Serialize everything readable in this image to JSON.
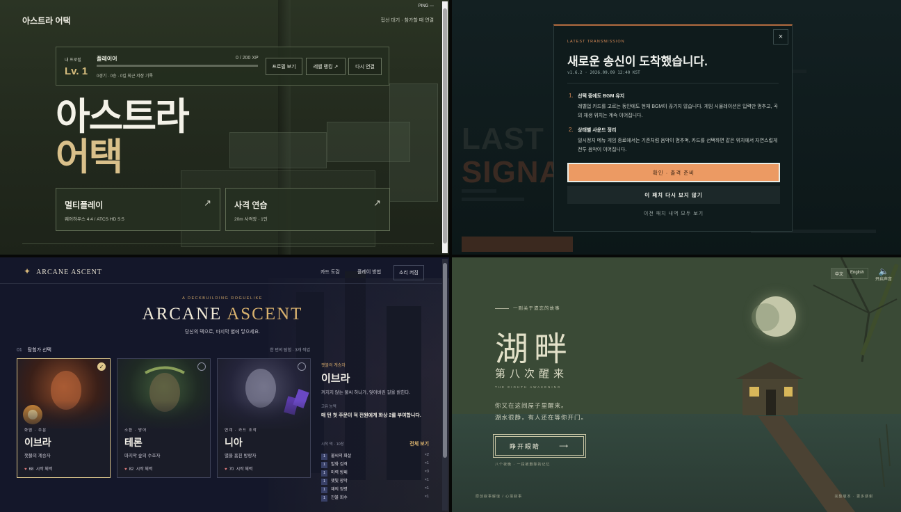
{
  "q1": {
    "logo": "아스트라 어택",
    "status": "접선 대기 · 참가할 때 연결",
    "ping": "PING —",
    "profile": {
      "label": "내 프로필",
      "level": "Lv. 1",
      "name": "플레이어",
      "xp_text": "0 / 200 XP",
      "xp_fraction": 0.0,
      "record": "0경기 · 0승 · 0킬  최근 저장 기록",
      "buttons": [
        "프로필 보기",
        "레벨 랭킹 ↗",
        "다시 연결"
      ]
    },
    "hero": {
      "line1": "아스트라",
      "line2": "어택"
    },
    "modes": [
      {
        "title": "멀티플레이",
        "sub": "웨어하우스 4:4 / ATCS HD S:5",
        "arrow": "↗"
      },
      {
        "title": "사격 연습",
        "sub": "20m 사격장 · 1인",
        "arrow": "↗"
      }
    ]
  },
  "q2": {
    "ghost": {
      "line1": "LAST",
      "line2": "SIGNA"
    },
    "modal": {
      "tag": "LATEST TRANSMISSION",
      "close": "×",
      "title": "새로운 송신이 도착했습니다.",
      "version": "v1.6.2 · 2026.09.09 12:40 KST",
      "items": [
        {
          "num": "1.",
          "head": "선택 중에도 BGM 유지",
          "body": "레벨업 카드를 고르는 동안에도 현재 BGM이 끊기지 않습니다. 게임 시뮬레이션은 입력만 멈추고, 곡의 재생 위치는 계속 이어집니다."
        },
        {
          "num": "2.",
          "head": "상태별 사운드 정리",
          "body": "일시정지 메뉴 게임 종료에서는 기존처럼 음악이 멈추며, 카드를 선택하면 같은 위치에서 자연스럽게 전투 음악이 이어집니다."
        }
      ],
      "confirm": "확인 · 출격 준비",
      "never": "이 패치 다시 보지 않기",
      "all": "이전 패치 내역 모두 보기"
    }
  },
  "q3": {
    "logo": "ARCANE ASCENT",
    "nav": [
      "카드 도감",
      "플레이 방법",
      "소리 켜짐"
    ],
    "kicker": "A DECKBUILDING ROGUELIKE",
    "title_a": "ARCANE ",
    "title_b": "ASCENT",
    "subtitle": "당신의 덱으로, 마지막 별에 닿으세요.",
    "section_num": "01",
    "section": "탐험가 선택",
    "count": "한 번의 탐험 · 3개 직업",
    "cards": [
      {
        "role": "화염 · 주문",
        "name": "이브라",
        "epithet": "잿불의 계승자",
        "hp": "68",
        "hp_label": "시작 체력",
        "check": "✓"
      },
      {
        "role": "소환 · 방어",
        "name": "테론",
        "epithet": "마지막 숲의 수호자",
        "hp": "82",
        "hp_label": "시작 체력",
        "check": ""
      },
      {
        "role": "연계 · 카드 조작",
        "name": "니아",
        "epithet": "별을 훔친 방랑자",
        "hp": "70",
        "hp_label": "시작 체력",
        "check": ""
      }
    ],
    "detail": {
      "kicker": "잿불의 계승자",
      "name": "이브라",
      "desc": "꺼지지 않는 불씨 하나가, 잊어버린 길을 밝힌다.",
      "bonus_label": "고유 능력",
      "bonus": "매 턴 첫 주문이 적 전원에게 화상 2를 부여합니다.",
      "deck_label": "시작 덱 · 10장",
      "deck_all": "전체 보기",
      "deck": [
        {
          "cost": "1",
          "name": "불씨의 화살",
          "count": "×2"
        },
        {
          "cost": "1",
          "name": "발화 검격",
          "count": "×1"
        },
        {
          "cost": "1",
          "name": "마력 방패",
          "count": "×3"
        },
        {
          "cost": "1",
          "name": "잿빛 장막",
          "count": "×1"
        },
        {
          "cost": "1",
          "name": "재의 정령",
          "count": "×1"
        },
        {
          "cost": "1",
          "name": "잔불 회수",
          "count": "×1"
        }
      ]
    }
  },
  "q4": {
    "lang": [
      "中文",
      "English"
    ],
    "sound": "开启声音",
    "kicker": "一则关于遗忘的故事",
    "title": "湖畔",
    "subtitle": "第八次醒来",
    "en": "THE EIGHTH AWAKENING",
    "poem": [
      "你又在这间屋子里醒来。",
      "湖水很静，有人还在等你开门。"
    ],
    "button": "睁开眼睛",
    "arrow": "⟶",
    "hint": "八个夜晚 · 一段被删除的记忆",
    "foot_left": "原创叙事解谜 / 心境叙事",
    "foot_right": "完整版本 · 更多感谢"
  },
  "colors": {
    "q1_accent": "#d9c08a",
    "q2_accent": "#ec9a63",
    "q3_accent": "#d8b16e",
    "q4_accent": "#e2e0c8"
  }
}
